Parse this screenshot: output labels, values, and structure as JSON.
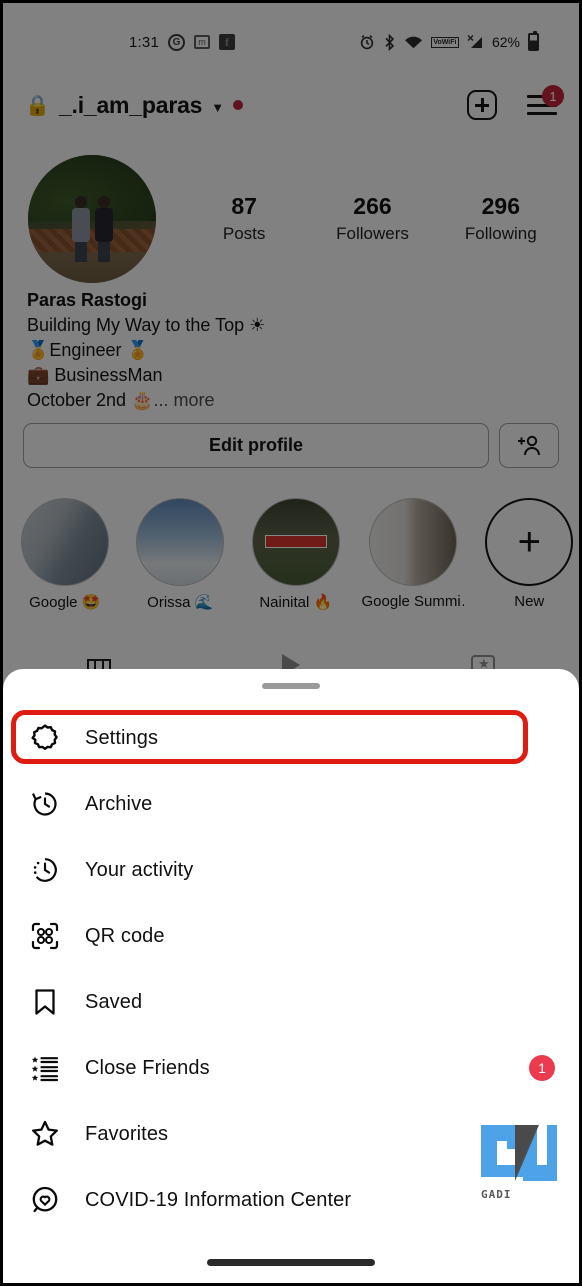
{
  "status_bar": {
    "time": "1:31",
    "left_icons": [
      "google-icon",
      "mastodon-icon",
      "facebook-icon"
    ],
    "right_icons": [
      "alarm-icon",
      "bluetooth-icon",
      "wifi-icon",
      "vowifi-icon",
      "signal-off-icon"
    ],
    "vowifi_line1": "Vo",
    "vowifi_line2": "WiFi",
    "battery_percent": "62%"
  },
  "profile_header": {
    "username": "_.i_am_paras",
    "lock_icon": "lock-icon",
    "chevron": "chevron-down-icon",
    "has_unread_dot": true,
    "add_post_icon": "plus-square-icon",
    "menu_icon": "hamburger-menu-icon",
    "menu_badge": "1"
  },
  "stats": [
    {
      "count": "87",
      "label": "Posts"
    },
    {
      "count": "266",
      "label": "Followers"
    },
    {
      "count": "296",
      "label": "Following"
    }
  ],
  "bio": {
    "name": "Paras Rastogi",
    "lines": [
      "Building My Way to the Top ☀",
      "🏅Engineer 🏅",
      "💼 BusinessMan"
    ],
    "last_line": "October 2nd 🎂",
    "more_label": "... more"
  },
  "buttons": {
    "edit_profile": "Edit profile",
    "add_person_icon": "add-person-icon"
  },
  "highlights": [
    {
      "label": "Google 🤩",
      "image": "google-building"
    },
    {
      "label": "Orissa 🌊",
      "image": "clouds-from-plane"
    },
    {
      "label": "Nainital 🔥",
      "image": "nainital-sign"
    },
    {
      "label": "Google Summi…",
      "image": "google-cloud-booth"
    },
    {
      "label": "New",
      "image": "plus-circle"
    }
  ],
  "tabs": [
    {
      "name": "grid-tab",
      "icon": "grid-icon",
      "active": true
    },
    {
      "name": "reels-tab",
      "icon": "reels-play-icon",
      "active": false
    },
    {
      "name": "tagged-tab",
      "icon": "tagged-person-icon",
      "active": false
    }
  ],
  "sheet": {
    "handle": "drag-handle",
    "items": [
      {
        "label": "Settings",
        "icon": "gear-icon",
        "badge": null,
        "highlighted": true
      },
      {
        "label": "Archive",
        "icon": "archive-clock-icon",
        "badge": null,
        "highlighted": false
      },
      {
        "label": "Your activity",
        "icon": "activity-clock-icon",
        "badge": null,
        "highlighted": false
      },
      {
        "label": "QR code",
        "icon": "qr-code-icon",
        "badge": null,
        "highlighted": false
      },
      {
        "label": "Saved",
        "icon": "bookmark-icon",
        "badge": null,
        "highlighted": false
      },
      {
        "label": "Close Friends",
        "icon": "star-list-icon",
        "badge": "1",
        "highlighted": false
      },
      {
        "label": "Favorites",
        "icon": "star-icon",
        "badge": null,
        "highlighted": false
      },
      {
        "label": "COVID-19 Information Center",
        "icon": "heart-circle-icon",
        "badge": null,
        "highlighted": false
      }
    ]
  },
  "watermark": {
    "text": "GADI",
    "logo": "gu-logo"
  },
  "colors": {
    "highlight_red": "#e01b12",
    "badge_red": "#ec3b4f",
    "menu_badge_red": "#c02338",
    "sheet_bg": "#ffffff",
    "watermark_blue": "#4ea3e8"
  },
  "nav_bar": {
    "pill": "home-gesture-pill"
  }
}
